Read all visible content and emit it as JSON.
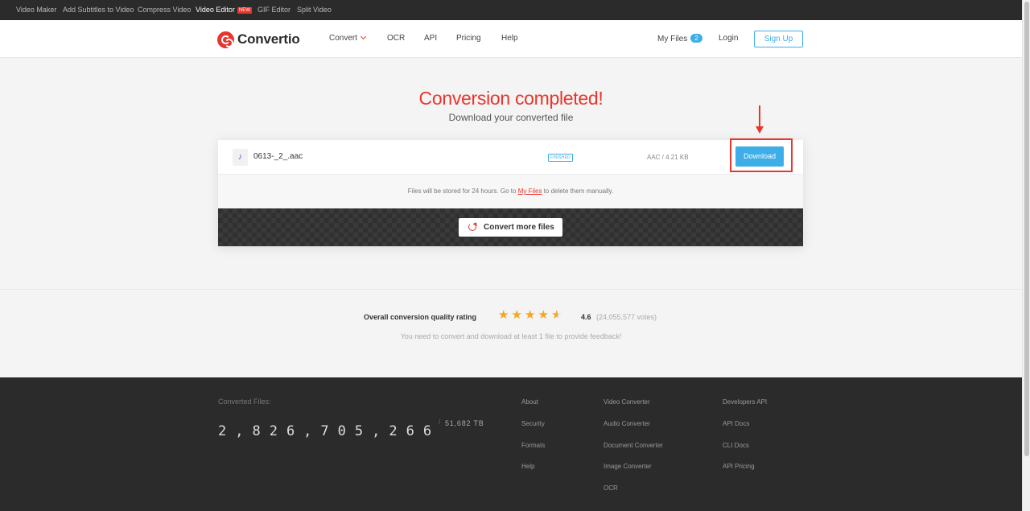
{
  "topbar": {
    "links": [
      {
        "label": "Video Maker",
        "active": false
      },
      {
        "label": "Add Subtitles to Video",
        "active": false
      },
      {
        "label": "Compress Video",
        "active": false
      },
      {
        "label": "Video Editor",
        "active": true,
        "badge": "NEW"
      },
      {
        "label": "GIF Editor",
        "active": false
      },
      {
        "label": "Split Video",
        "active": false
      }
    ]
  },
  "header": {
    "logo_text": "Convertio",
    "nav": {
      "convert": "Convert",
      "ocr": "OCR",
      "api": "API",
      "pricing": "Pricing",
      "help": "Help"
    },
    "my_files_label": "My Files",
    "my_files_count": "2",
    "login": "Login",
    "signup": "Sign Up"
  },
  "hero": {
    "title": "Conversion completed!",
    "subtitle": "Download your converted file"
  },
  "file": {
    "name": "0613-_2_.aac",
    "status": "FINISHED",
    "meta": "AAC / 4.21 KB",
    "download_label": "Download",
    "icon": "music-note-icon"
  },
  "storage": {
    "prefix": "Files will be stored for 24 hours. Go to",
    "link": "My Files",
    "suffix": "to delete them manually."
  },
  "convert_more_label": "Convert more files",
  "rating": {
    "label": "Overall conversion quality rating",
    "value": 4.6,
    "score": "4.6",
    "votes": "(24,055,577 votes)",
    "note": "You need to convert and download at least 1 file to provide feedback!"
  },
  "footer": {
    "converted_label": "Converted Files:",
    "counter": "2,826,705,266",
    "tb_slash": "/",
    "tb": "51,682 TB",
    "col1": [
      "About",
      "Security",
      "Formats",
      "Help"
    ],
    "col2": [
      "Video Converter",
      "Audio Converter",
      "Document Converter",
      "Image Converter",
      "OCR"
    ],
    "col3": [
      "Developers API",
      "API Docs",
      "CLI Docs",
      "API Pricing"
    ]
  },
  "colors": {
    "accent_red": "#e8352d",
    "accent_blue": "#3eaee8",
    "dark_bg": "#2b2b2b",
    "star": "#f5a623"
  }
}
